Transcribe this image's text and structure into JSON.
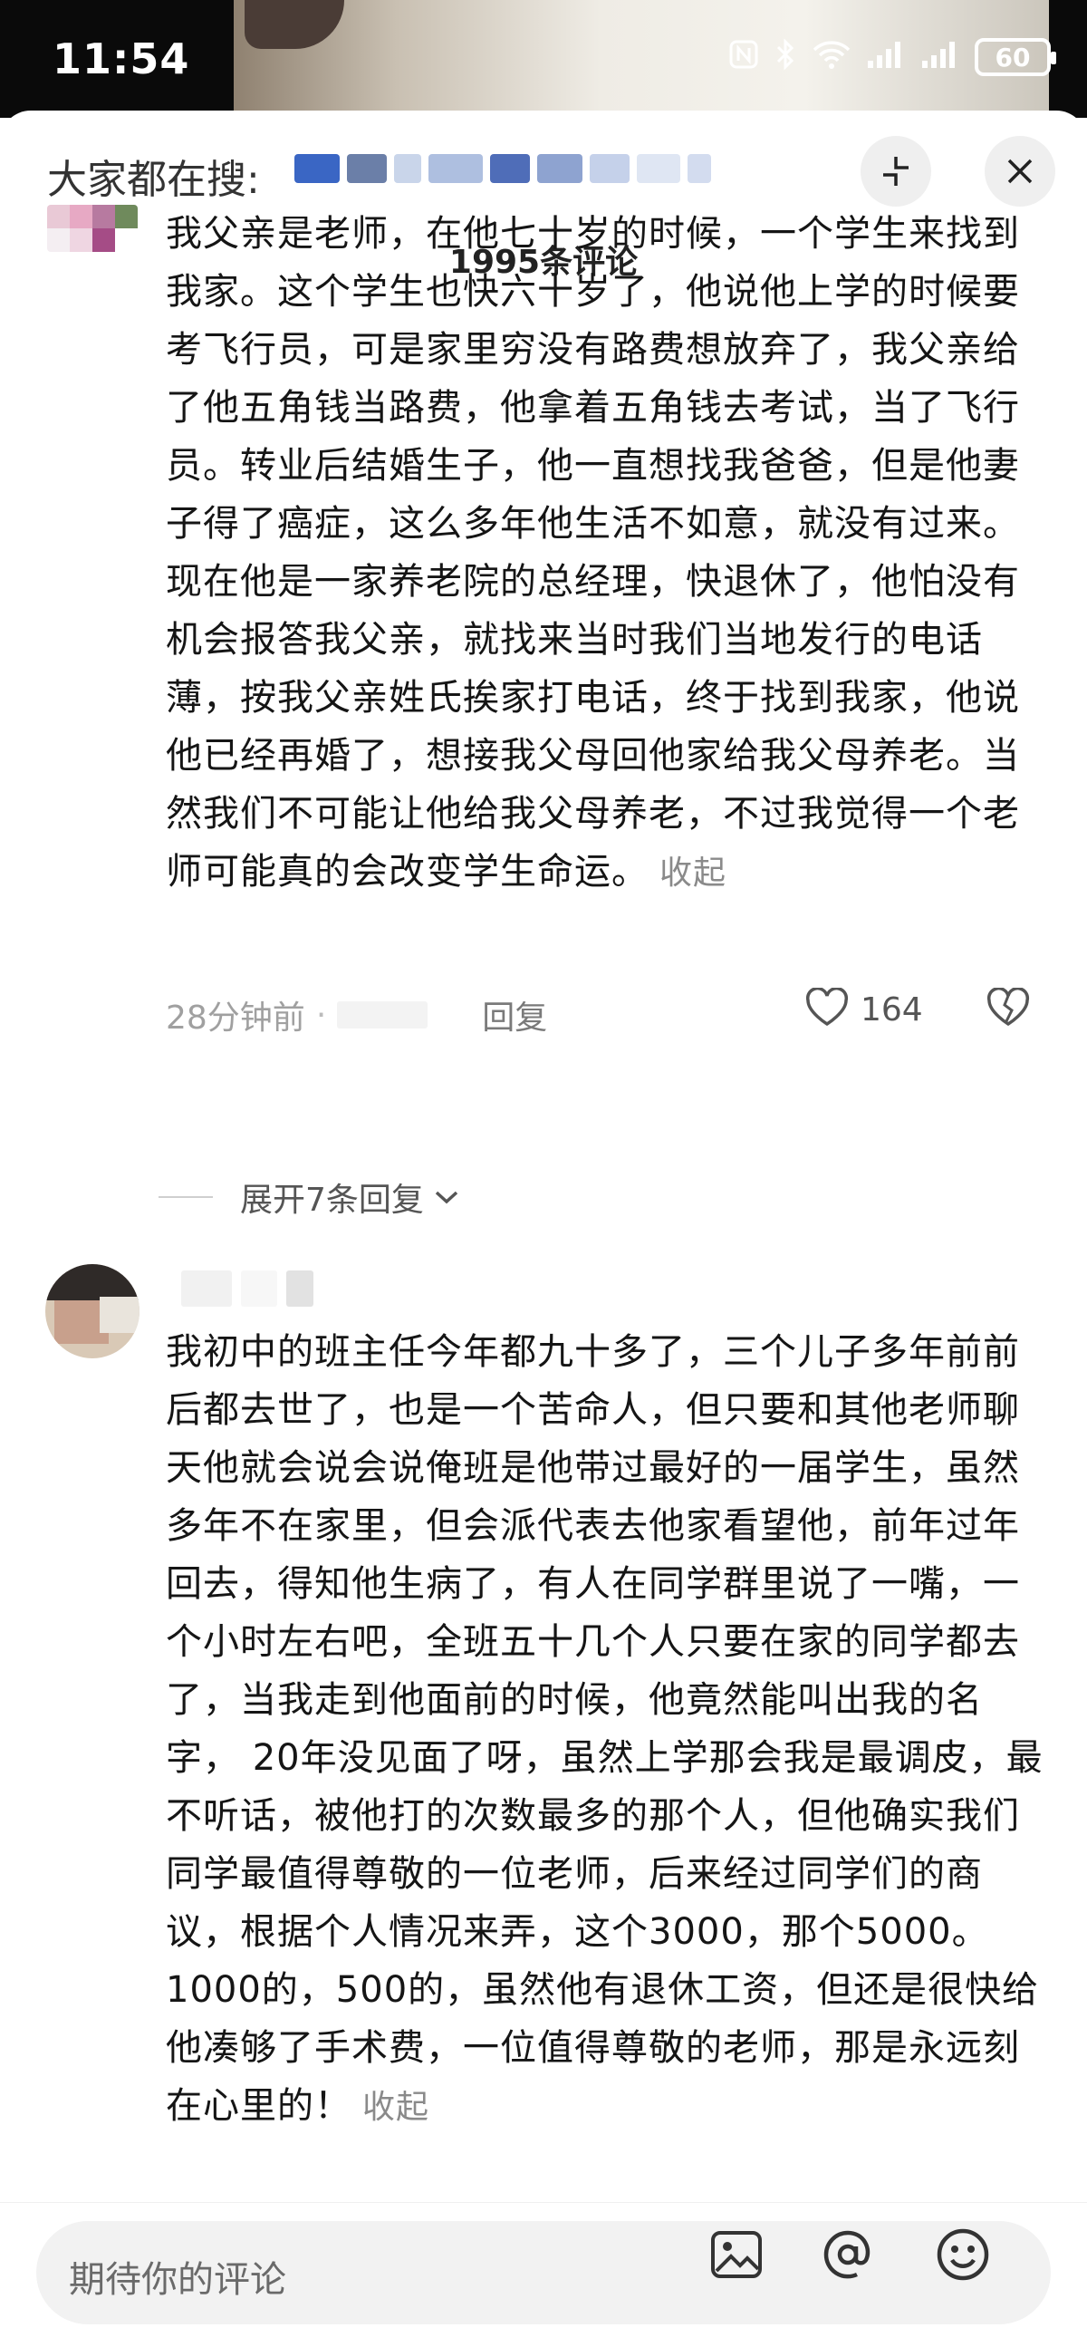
{
  "status_bar": {
    "time": "11:54",
    "battery": "60",
    "icons": [
      "nfc-icon",
      "bluetooth-icon",
      "wifi-icon",
      "signal-icon",
      "signal-icon",
      "battery-icon"
    ]
  },
  "header": {
    "search_hint": "大家都在搜:",
    "comment_count": "1995条评论"
  },
  "comments": [
    {
      "text": "我父亲是老师，在他七十岁的时候，一个学生来找到我家。这个学生也快六十岁了，他说他上学的时候要考飞行员，可是家里穷没有路费想放弃了，我父亲给了他五角钱当路费，他拿着五角钱去考试，当了飞行员。转业后结婚生子，他一直想找我爸爸，但是他妻子得了癌症，这么多年他生活不如意，就没有过来。现在他是一家养老院的总经理，快退休了，他怕没有机会报答我父亲，就找来当时我们当地发行的电话薄，按我父亲姓氏挨家打电话，终于找到我家，他说他已经再婚了，想接我父母回他家给我父母养老。当然我们不可能让他给我父母养老，不过我觉得一个老师可能真的会改变学生命运。",
      "collapse": "收起",
      "time": "28分钟前",
      "dot": "·",
      "reply": "回复",
      "likes": "164",
      "expand_replies": "展开7条回复"
    },
    {
      "text": "我初中的班主任今年都九十多了，三个儿子多年前前后都去世了，也是一个苦命人，但只要和其他老师聊天他就会说会说俺班是他带过最好的一届学生，虽然多年不在家里，但会派代表去他家看望他，前年过年回去，得知他生病了，有人在同学群里说了一嘴，一个小时左右吧，全班五十几个人只要在家的同学都去了，当我走到他面前的时候，他竟然能叫出我的名字， 20年没见面了呀，虽然上学那会我是最调皮，最不听话，被他打的次数最多的那个人，但他确实我们同学最值得尊敬的一位老师，后来经过同学们的商议，根据个人情况来弄，这个3000，那个5000。1000的，500的，虽然他有退休工资，但还是很快给他凑够了手术费，一位值得尊敬的老师，那是永远刻在心里的！",
      "collapse": "收起"
    }
  ],
  "input_bar": {
    "placeholder": "期待你的评论",
    "icons": [
      "image-icon",
      "at-icon",
      "emoji-icon"
    ]
  },
  "colors": {
    "accent_text": "#151515",
    "muted": "#a0a0a0",
    "input_bg": "#f2f2f2"
  }
}
